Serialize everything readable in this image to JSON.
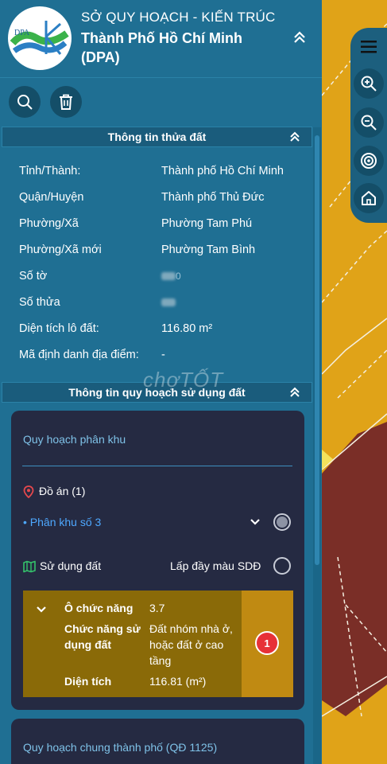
{
  "header": {
    "org_line1": "SỞ QUY HOẠCH - KIẾN TRÚC",
    "org_line2": "Thành Phố Hồ Chí Minh (DPA)",
    "logo_text": "DPA"
  },
  "parcel_section": {
    "title": "Thông tin thửa đất",
    "rows": [
      {
        "label": "Tỉnh/Thành:",
        "value": "Thành phố Hồ Chí Minh"
      },
      {
        "label": "Quận/Huyện",
        "value": "Thành phố Thủ Đức"
      },
      {
        "label": "Phường/Xã",
        "value": "Phường Tam Phú"
      },
      {
        "label": "Phường/Xã mới",
        "value": "Phường Tam Bình"
      },
      {
        "label": "Số tờ",
        "value": "0"
      },
      {
        "label": "Số thửa",
        "value": ""
      },
      {
        "label": "Diện tích lô đất:",
        "value": "116.80 m²"
      },
      {
        "label": "Mã định danh địa điểm:",
        "value": "-"
      }
    ]
  },
  "planning_section": {
    "title": "Thông tin quy hoạch sử dụng đất",
    "zone_card": {
      "title": "Quy hoạch phân khu",
      "project_label": "Đồ án (1)",
      "zone_item": "• Phân khu số 3",
      "land_use_label": "Sử dụng đất",
      "fill_color_label": "Lấp đầy màu SDĐ",
      "function_box": {
        "cell_label": "Ô chức năng",
        "cell_value": "3.7",
        "usage_label": "Chức năng sử dụng đất",
        "usage_value": "Đất nhóm nhà ở, hoặc đất ở cao tầng",
        "area_label": "Diện tích",
        "area_value": "116.81 (m²)",
        "badge": "1"
      }
    },
    "general_card": {
      "title": "Quy hoạch chung thành phố (QĐ 1125)"
    }
  },
  "watermark": "chợTỐT",
  "colors": {
    "panel_bg": "#1f6f93",
    "card_bg": "#252a42",
    "map_yellow": "#e0a318",
    "map_red": "#7a2e27",
    "function_box": "#8a6a08",
    "badge": "#e73137",
    "link": "#4ea8ff"
  }
}
